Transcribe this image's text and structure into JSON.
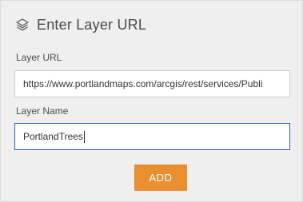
{
  "header": {
    "title": "Enter Layer URL",
    "icon": "layers-icon"
  },
  "form": {
    "url_label": "Layer URL",
    "url_value": "https://www.portlandmaps.com/arcgis/rest/services/Publi",
    "name_label": "Layer Name",
    "name_value": "PortlandTrees",
    "add_label": "ADD"
  },
  "colors": {
    "panel_background": "#efefef",
    "button_accent": "#e88f2f",
    "focus_border": "#2f5fa6"
  }
}
